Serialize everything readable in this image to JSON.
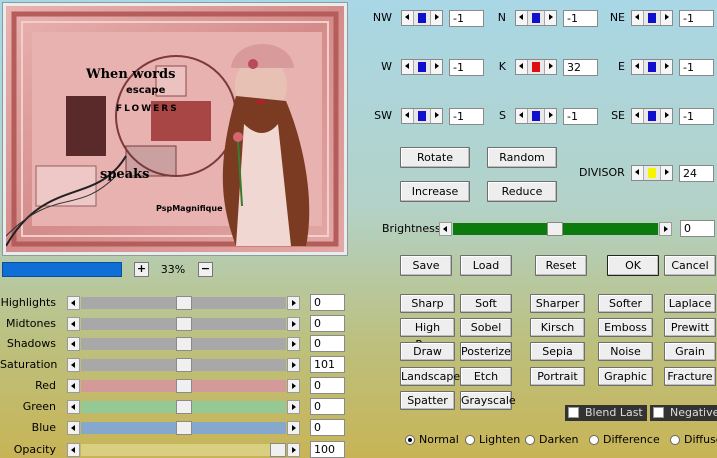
{
  "preview": {
    "text_line1": "When words",
    "text_line2": "escape",
    "text_line3": "FLOWERS",
    "text_line4": "speaks",
    "watermark": "PspMagnifique"
  },
  "zoom": {
    "minus": "−",
    "plus": "+",
    "value": "33%"
  },
  "sliders": [
    {
      "label": "Highlights",
      "value": "0",
      "pos": 0.5,
      "color": "#a8a8a8"
    },
    {
      "label": "Midtones",
      "value": "0",
      "pos": 0.5,
      "color": "#a8a8a8"
    },
    {
      "label": "Shadows",
      "value": "0",
      "pos": 0.5,
      "color": "#a8a8a8"
    },
    {
      "label": "Saturation",
      "value": "101",
      "pos": 0.5,
      "color": "#a8a8a8"
    },
    {
      "label": "Red",
      "value": "0",
      "pos": 0.5,
      "color": "#d49a9a"
    },
    {
      "label": "Green",
      "value": "0",
      "pos": 0.5,
      "color": "#94c894"
    },
    {
      "label": "Blue",
      "value": "0",
      "pos": 0.5,
      "color": "#86a8cc"
    },
    {
      "label": "Opacity",
      "value": "100",
      "pos": 1.0,
      "color": "#d8d080"
    }
  ],
  "matrix": [
    {
      "label": "NW",
      "value": "-1",
      "marker": "#1010cc"
    },
    {
      "label": "N",
      "value": "-1",
      "marker": "#1010cc"
    },
    {
      "label": "NE",
      "value": "-1",
      "marker": "#1010cc"
    },
    {
      "label": "W",
      "value": "-1",
      "marker": "#1010cc"
    },
    {
      "label": "K",
      "value": "32",
      "marker": "#dd1111"
    },
    {
      "label": "E",
      "value": "-1",
      "marker": "#1010cc"
    },
    {
      "label": "SW",
      "value": "-1",
      "marker": "#1010cc"
    },
    {
      "label": "S",
      "value": "-1",
      "marker": "#1010cc"
    },
    {
      "label": "SE",
      "value": "-1",
      "marker": "#1010cc"
    }
  ],
  "ops": {
    "rotate": "Rotate",
    "random": "Random",
    "increase": "Increase",
    "reduce": "Reduce"
  },
  "divisor": {
    "label": "DIVISOR",
    "value": "24",
    "marker": "#f5f500"
  },
  "brightness": {
    "label": "Brightness",
    "value": "0",
    "color": "#0d7a0d"
  },
  "actions": {
    "save": "Save",
    "load": "Load",
    "reset": "Reset",
    "ok": "OK",
    "cancel": "Cancel"
  },
  "presets": [
    [
      "Sharp",
      "Soft",
      "Sharper",
      "Softer",
      "Laplace"
    ],
    [
      "High Pass",
      "Sobel",
      "Kirsch",
      "Emboss",
      "Prewitt"
    ],
    [
      "Draw",
      "Posterize",
      "Sepia",
      "Noise",
      "Grain"
    ],
    [
      "Landscape",
      "Etch",
      "Portrait",
      "Graphic",
      "Fracture"
    ],
    [
      "Spatter",
      "Grayscale"
    ]
  ],
  "checks": {
    "blend_last": "Blend Last",
    "negative": "Negative"
  },
  "modes": [
    {
      "label": "Normal",
      "selected": true
    },
    {
      "label": "Lighten",
      "selected": false
    },
    {
      "label": "Darken",
      "selected": false
    },
    {
      "label": "Difference",
      "selected": false
    },
    {
      "label": "Diffuse",
      "selected": false
    }
  ]
}
